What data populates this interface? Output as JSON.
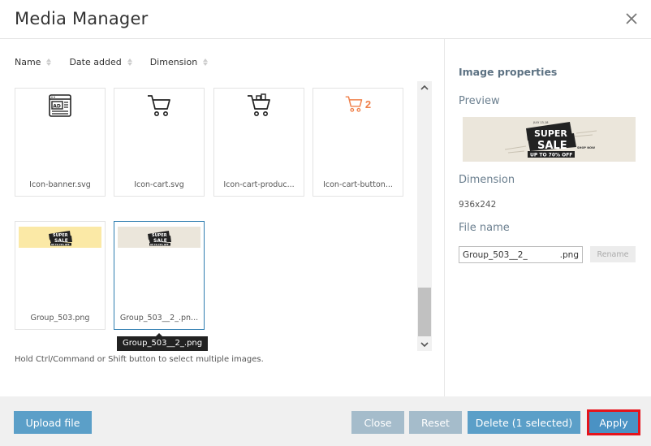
{
  "dialog": {
    "title": "Media Manager"
  },
  "sort": {
    "columns": [
      "Name",
      "Date added",
      "Dimension"
    ]
  },
  "files": [
    {
      "name": "Icon-banner.svg",
      "icon": "banner-icon"
    },
    {
      "name": "Icon-cart.svg",
      "icon": "cart-icon"
    },
    {
      "name": "Icon-cart-produc...",
      "icon": "cart-product-icon"
    },
    {
      "name": "Icon-cart-button...",
      "icon": "cart-button-icon",
      "badge": "2"
    },
    {
      "name": "Group_503.png",
      "icon": "sale-banner-yellow"
    },
    {
      "name": "Group_503__2_.pn...",
      "icon": "sale-banner-beige",
      "selected": true
    }
  ],
  "banner_text": {
    "line1": "SUPER",
    "line2": "SALE",
    "line3": "UP TO 70% OFF",
    "shop": "SHOP NOW",
    "tag": "JULY 13-18"
  },
  "tooltip": "Group_503__2_.png",
  "hint": "Hold Ctrl/Command or Shift button to select multiple images.",
  "properties": {
    "title": "Image properties",
    "preview_label": "Preview",
    "dimension_label": "Dimension",
    "dimension_value": "936x242",
    "filename_label": "File name",
    "filename_value": "Group_503__2_",
    "filename_ext": ".png",
    "rename_label": "Rename"
  },
  "footer": {
    "upload": "Upload file",
    "close": "Close",
    "reset": "Reset",
    "delete": "Delete (1 selected)",
    "apply": "Apply"
  },
  "colors": {
    "accent": "#5b9fc8",
    "disabled": "#a5bccb",
    "highlight": "#e5141c",
    "cart_orange": "#f0804a"
  }
}
